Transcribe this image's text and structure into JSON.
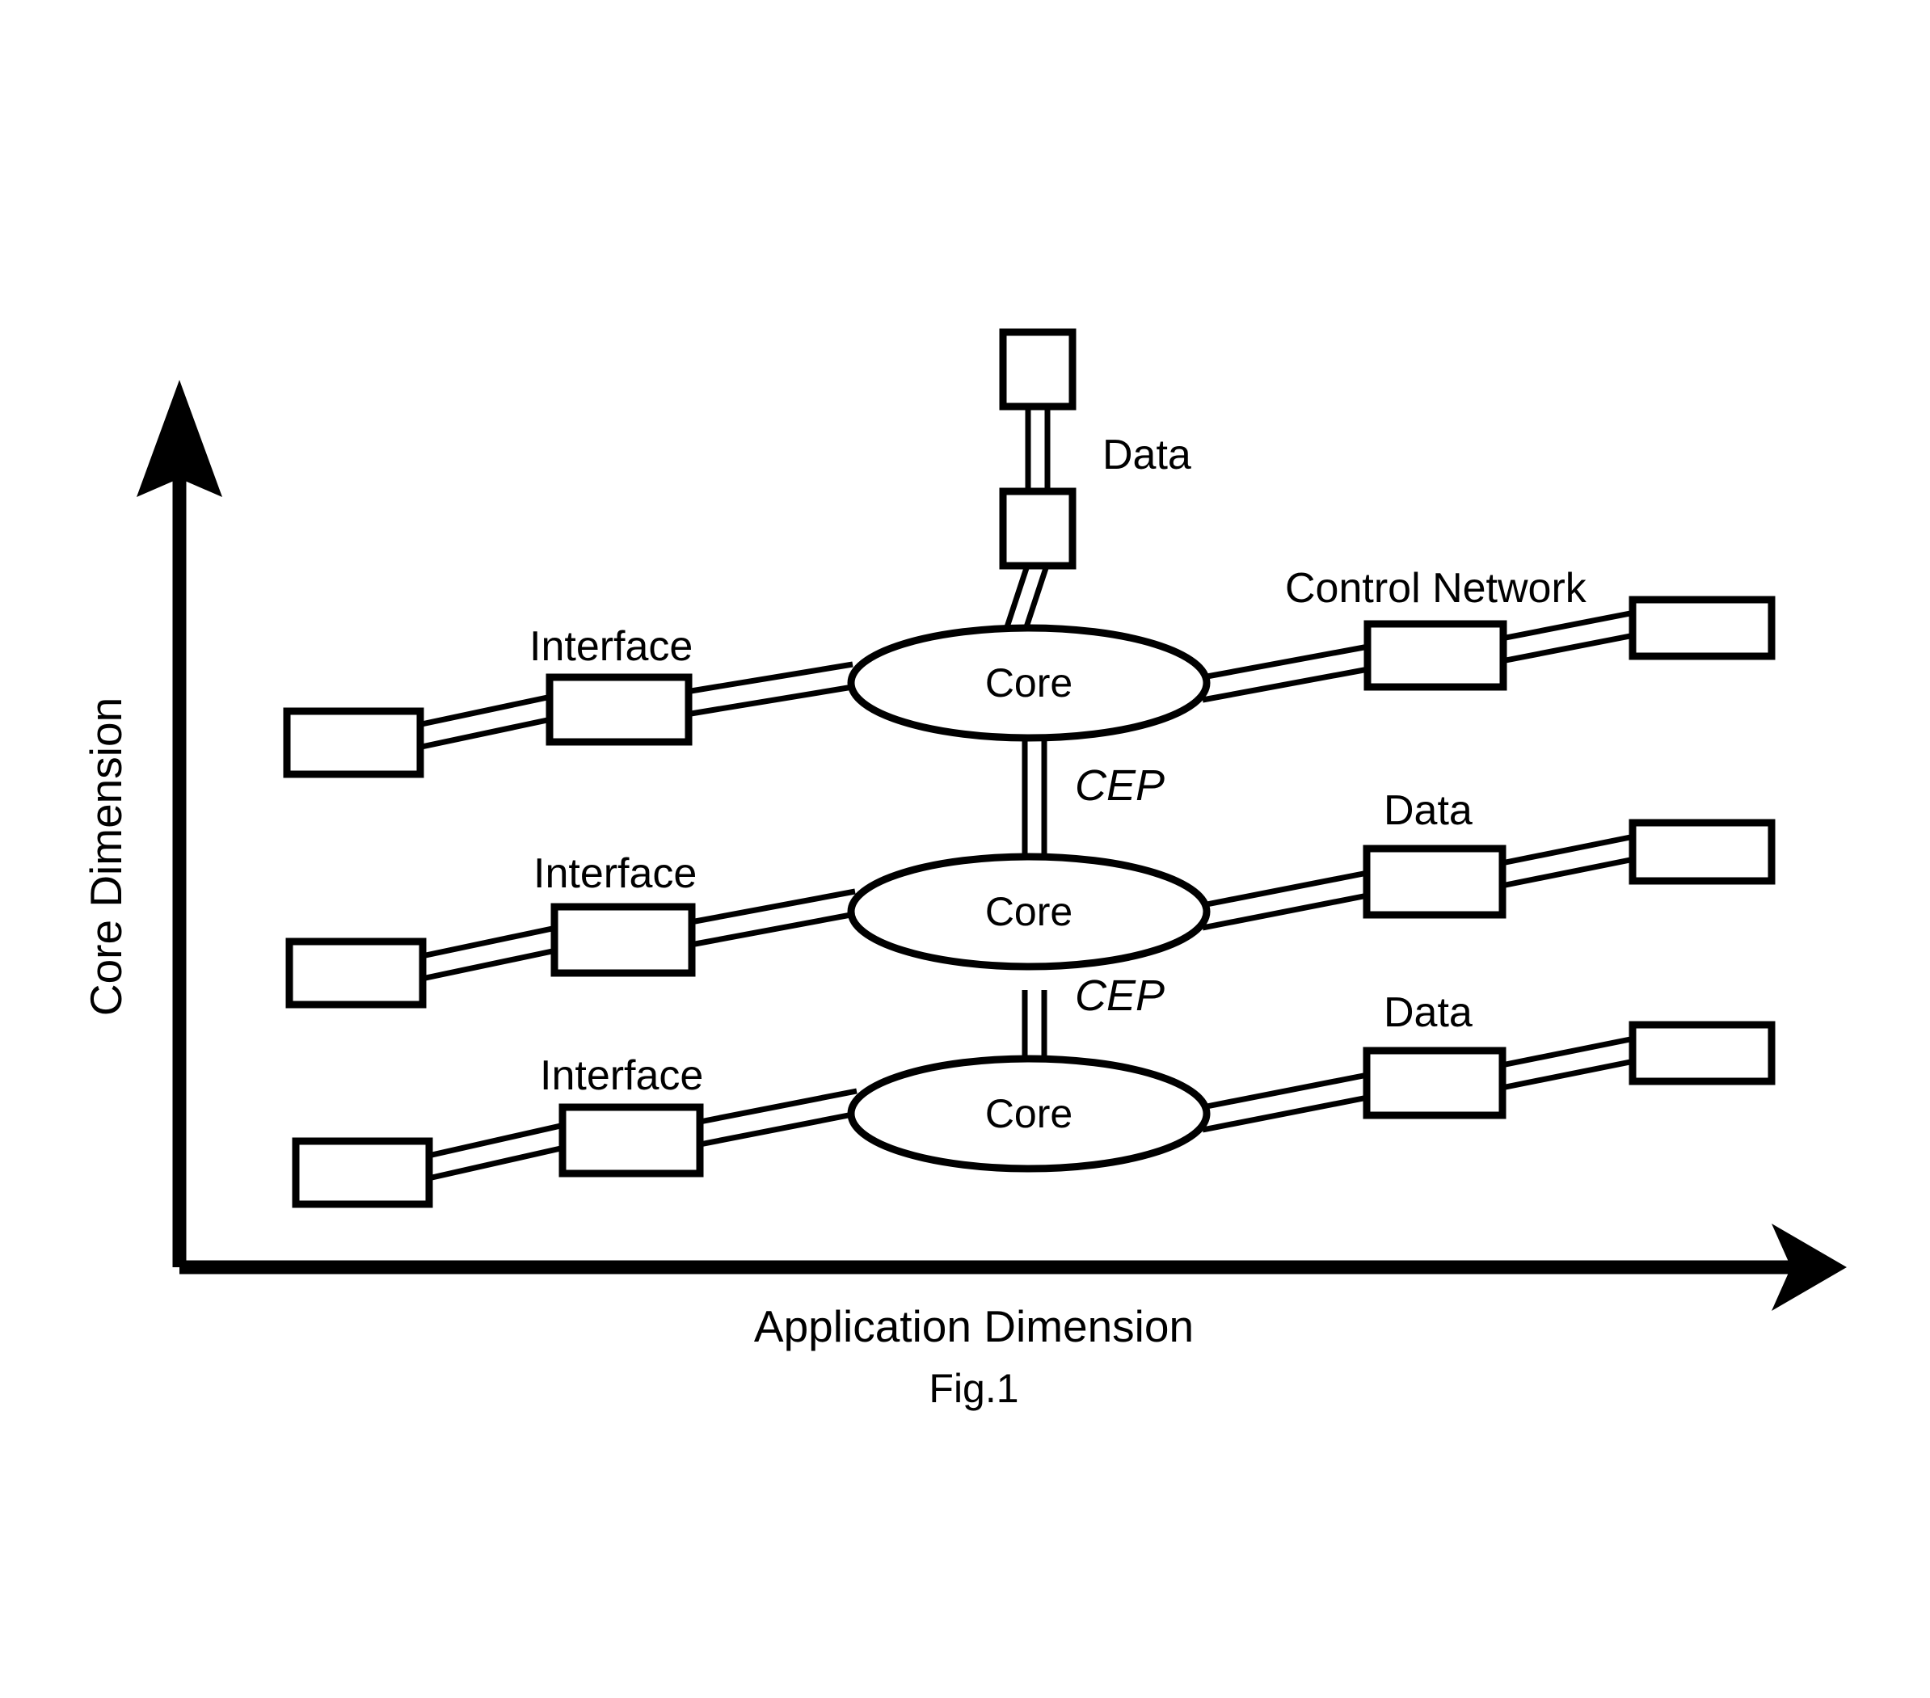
{
  "figure": {
    "caption": "Fig.1",
    "x_axis_label": "Application Dimension",
    "y_axis_label": "Core Dimension"
  },
  "labels": {
    "interface": "Interface",
    "core": "Core",
    "cep": "CEP",
    "data": "Data",
    "control_network": "Control Network"
  },
  "rows": [
    {
      "id": "row-top",
      "core_label": "Core",
      "left_interface_label": "Interface",
      "right_label": "Control Network",
      "vertical_label": "Data"
    },
    {
      "id": "row-middle",
      "core_label": "Core",
      "left_interface_label": "Interface",
      "right_label": "Data",
      "vertical_label": "CEP"
    },
    {
      "id": "row-bottom",
      "core_label": "Core",
      "left_interface_label": "Interface",
      "right_label": "Data",
      "vertical_label": "CEP"
    }
  ],
  "colors": {
    "stroke": "#000000",
    "fill": "#ffffff",
    "background": "#ffffff"
  },
  "chart_data": {
    "type": "diagram",
    "title": "Fig.1",
    "xlabel": "Application Dimension",
    "ylabel": "Core Dimension",
    "grid": false,
    "nodes": [
      {
        "name": "top-chain-end-box",
        "shape": "rect",
        "label": ""
      },
      {
        "name": "top-chain-mid-box",
        "shape": "rect",
        "label": ""
      },
      {
        "name": "core-top",
        "shape": "ellipse",
        "label": "Core"
      },
      {
        "name": "core-middle",
        "shape": "ellipse",
        "label": "Core"
      },
      {
        "name": "core-bottom",
        "shape": "ellipse",
        "label": "Core"
      },
      {
        "name": "interface-box-top",
        "shape": "rect",
        "label": ""
      },
      {
        "name": "interface-box-middle",
        "shape": "rect",
        "label": ""
      },
      {
        "name": "interface-box-bottom",
        "shape": "rect",
        "label": ""
      },
      {
        "name": "endpoint-box-top-left",
        "shape": "rect",
        "label": ""
      },
      {
        "name": "endpoint-box-middle-left",
        "shape": "rect",
        "label": ""
      },
      {
        "name": "endpoint-box-bottom-left",
        "shape": "rect",
        "label": ""
      },
      {
        "name": "control-network-box-top",
        "shape": "rect",
        "label": ""
      },
      {
        "name": "endpoint-box-top-right",
        "shape": "rect",
        "label": ""
      },
      {
        "name": "data-box-middle",
        "shape": "rect",
        "label": ""
      },
      {
        "name": "endpoint-box-middle-right",
        "shape": "rect",
        "label": ""
      },
      {
        "name": "data-box-bottom",
        "shape": "rect",
        "label": ""
      },
      {
        "name": "endpoint-box-bottom-right",
        "shape": "rect",
        "label": ""
      }
    ],
    "edges": [
      {
        "from": "top-chain-end-box",
        "to": "top-chain-mid-box",
        "label": "Data"
      },
      {
        "from": "top-chain-mid-box",
        "to": "core-top",
        "label": ""
      },
      {
        "from": "core-top",
        "to": "core-middle",
        "label": "CEP"
      },
      {
        "from": "core-middle",
        "to": "core-bottom",
        "label": "CEP"
      },
      {
        "from": "endpoint-box-top-left",
        "to": "interface-box-top",
        "label": "Interface"
      },
      {
        "from": "interface-box-top",
        "to": "core-top",
        "label": ""
      },
      {
        "from": "core-top",
        "to": "control-network-box-top",
        "label": "Control Network"
      },
      {
        "from": "control-network-box-top",
        "to": "endpoint-box-top-right",
        "label": ""
      },
      {
        "from": "endpoint-box-middle-left",
        "to": "interface-box-middle",
        "label": "Interface"
      },
      {
        "from": "interface-box-middle",
        "to": "core-middle",
        "label": ""
      },
      {
        "from": "core-middle",
        "to": "data-box-middle",
        "label": "Data"
      },
      {
        "from": "data-box-middle",
        "to": "endpoint-box-middle-right",
        "label": ""
      },
      {
        "from": "endpoint-box-bottom-left",
        "to": "interface-box-bottom",
        "label": "Interface"
      },
      {
        "from": "interface-box-bottom",
        "to": "core-bottom",
        "label": ""
      },
      {
        "from": "core-bottom",
        "to": "data-box-bottom",
        "label": "Data"
      },
      {
        "from": "data-box-bottom",
        "to": "endpoint-box-bottom-right",
        "label": ""
      }
    ]
  }
}
